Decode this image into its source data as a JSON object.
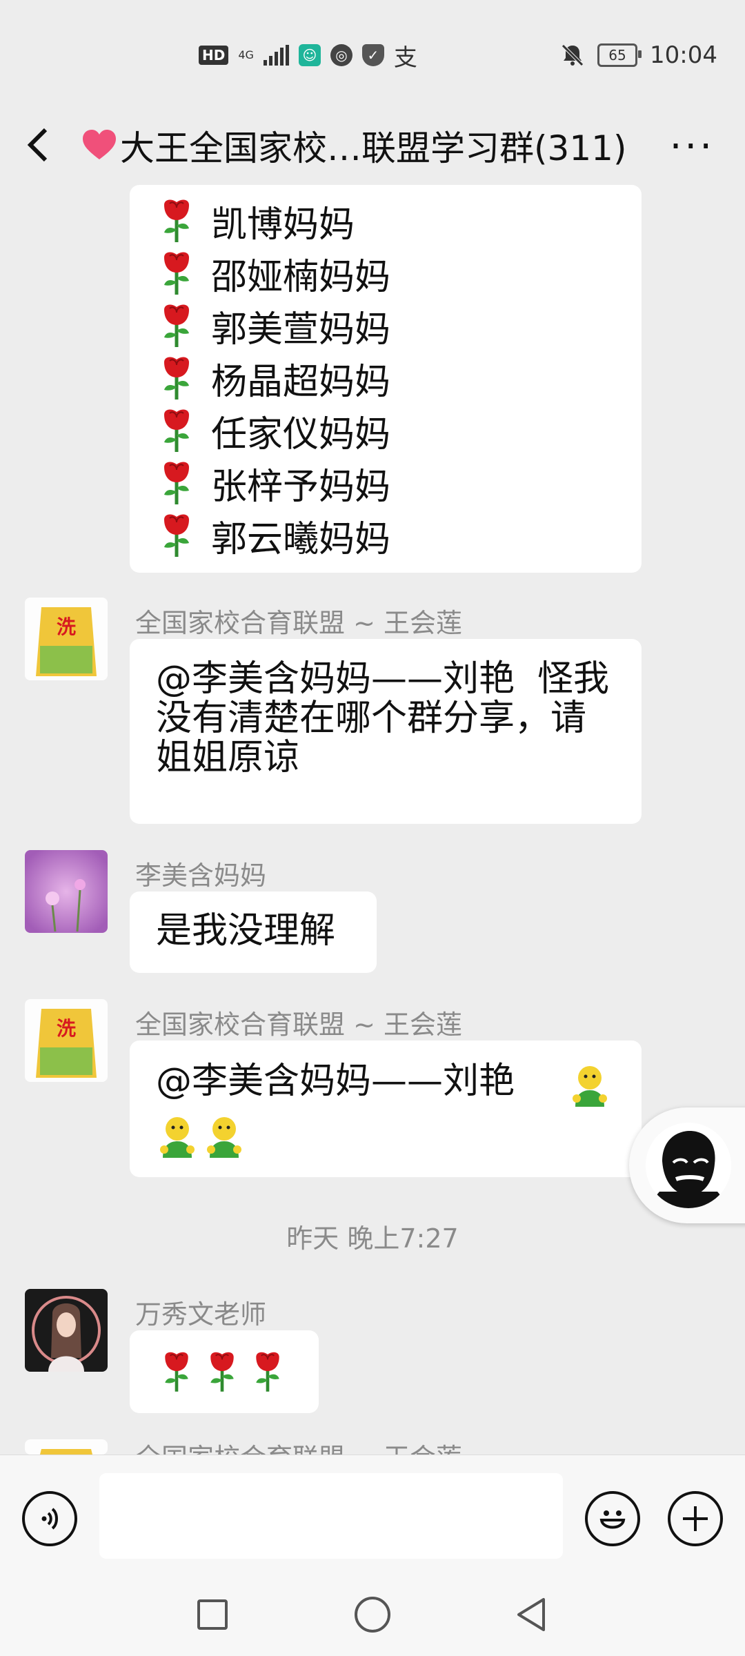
{
  "status_bar": {
    "hd": "HD",
    "network": "4G",
    "battery": "65",
    "time": "10:04"
  },
  "header": {
    "title": "大王全国家校…联盟学习群(311)",
    "back_icon": "chevron-left-icon",
    "more_icon": "more-dots-icon"
  },
  "messages": {
    "rose_list": [
      "凯博妈妈",
      "邵娅楠妈妈",
      "郭美萱妈妈",
      "杨晶超妈妈",
      "任家仪妈妈",
      "张梓予妈妈",
      "郭云曦妈妈"
    ],
    "m1": {
      "sender": "全国家校合育联盟 ~ 王会莲",
      "text": "@李美含妈妈——刘艳  怪我没有清楚在哪个群分享，请姐姐原谅"
    },
    "m2": {
      "sender": "李美含妈妈",
      "text": "是我没理解"
    },
    "m3": {
      "sender": "全国家校合育联盟 ~ 王会莲",
      "text": "@李美含妈妈——刘艳"
    },
    "timestamp": "昨天 晚上7:27",
    "m4": {
      "sender": "万秀文老师"
    },
    "m5": {
      "sender": "全国家校合育联盟 ~ 王会莲"
    }
  },
  "input_bar": {
    "value": "",
    "voice_icon": "voice-icon",
    "emoji_icon": "emoji-icon",
    "plus_icon": "plus-icon"
  },
  "nav_bar": {
    "recent_icon": "square-icon",
    "home_icon": "circle-icon",
    "back_icon": "triangle-back-icon"
  }
}
